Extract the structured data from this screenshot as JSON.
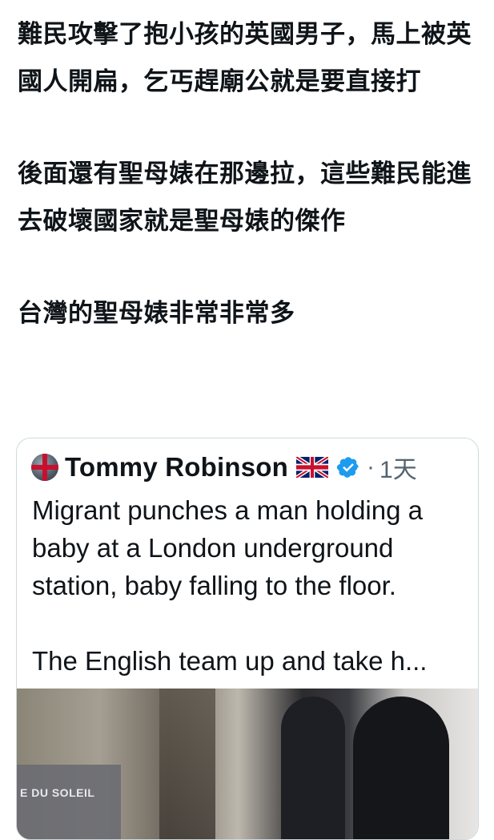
{
  "post": {
    "paragraphs": [
      "難民攻擊了抱小孩的英國男子，馬上被英國人開扁，乞丐趕廟公就是要直接打",
      "後面還有聖母婊在那邊拉，這些難民能進去破壞國家就是聖母婊的傑作",
      "台灣的聖母婊非常非常多"
    ]
  },
  "quoted_post": {
    "display_name": "Tommy Robinson",
    "flag_icon": "uk-flag-icon",
    "verified_icon": "verified-badge-icon",
    "dot": "·",
    "timestamp": "1天",
    "text_lines": [
      "Migrant punches a man holding a baby at a London underground station, baby falling to the floor.",
      "The English team up and take h..."
    ],
    "media_overlay_text": "E DU SOLEIL"
  },
  "colors": {
    "text_primary": "#0f1419",
    "text_secondary": "#536471",
    "verified_blue": "#1d9bf0",
    "card_border": "#cfd9de"
  }
}
